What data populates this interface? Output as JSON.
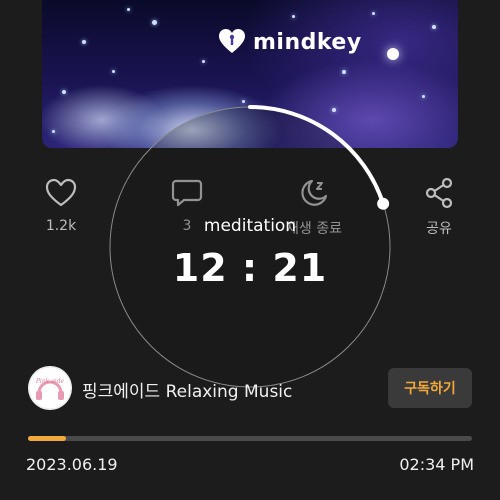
{
  "brand": {
    "name": "mindkey",
    "icon": "heart-keyhole-icon"
  },
  "actions": [
    {
      "id": "like",
      "icon": "heart-icon",
      "label": "1.2k"
    },
    {
      "id": "comment",
      "icon": "comment-icon",
      "label": "3"
    },
    {
      "id": "sleep-timer",
      "icon": "moon-zz-icon",
      "label": "재생 종료"
    },
    {
      "id": "share",
      "icon": "share-icon",
      "label": "공유"
    }
  ],
  "timer": {
    "label": "meditation",
    "value": "12 : 21",
    "progress": 0.2
  },
  "channel": {
    "avatar_text": "Pink aide",
    "name": "핑크에이드 Relaxing Music",
    "subscribe_label": "구독하기"
  },
  "playback": {
    "progress": 0.085,
    "date": "2023.06.19",
    "time": "02:34 PM"
  },
  "colors": {
    "accent": "#f2a93a",
    "background": "#1c1c1c",
    "ring": "#ffffff"
  }
}
